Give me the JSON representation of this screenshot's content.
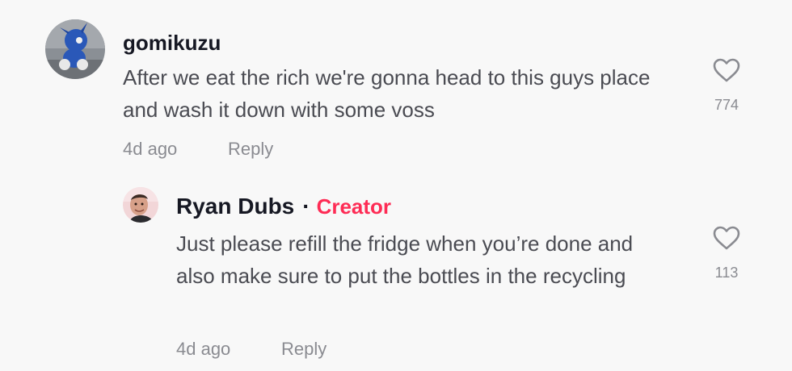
{
  "comments": [
    {
      "username": "gomikuzu",
      "text": "After we eat the rich we're gonna head to this guys place and wash it down with some voss",
      "time": "4d ago",
      "reply_label": "Reply",
      "likes": "774",
      "avatar_icon": "avatar-icon"
    }
  ],
  "replies": [
    {
      "username": "Ryan Dubs",
      "separator": "·",
      "badge": "Creator",
      "text": "Just please refill the fridge when you’re done and also make sure to put the bottles in the recycling",
      "time": "4d ago",
      "reply_label": "Reply",
      "likes": "113",
      "avatar_icon": "avatar-icon"
    }
  ],
  "colors": {
    "background": "#f8f8f8",
    "username": "#161823",
    "text": "#4a4b52",
    "meta": "#8a8b91",
    "creator_badge": "#fe2c55"
  },
  "icons": {
    "like": "heart-outline-icon"
  }
}
